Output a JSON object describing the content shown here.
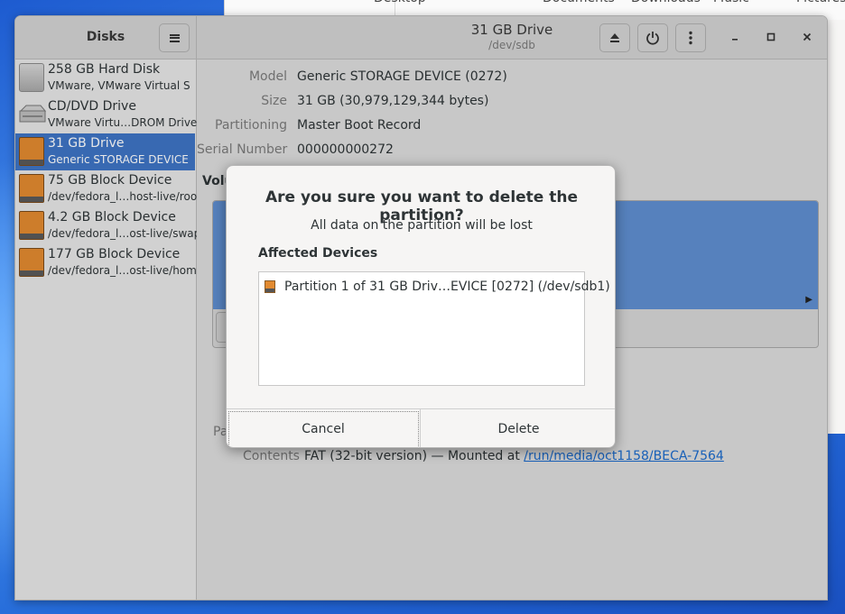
{
  "desktop": {
    "behind_window_labels": [
      "Desktop",
      "Documents",
      "Downloads",
      "Music",
      "Pictures"
    ]
  },
  "sidebar": {
    "title": "Disks",
    "items": [
      {
        "name": "258 GB Hard Disk",
        "desc": "VMware, VMware Virtual S",
        "icon": "hard-disk-icon",
        "selected": false
      },
      {
        "name": "CD/DVD Drive",
        "desc": "VMware Virtu…DROM Drive",
        "icon": "cd-drive-icon",
        "selected": false
      },
      {
        "name": "31 GB Drive",
        "desc": "Generic STORAGE DEVICE",
        "icon": "usb-drive-icon",
        "selected": true
      },
      {
        "name": "75 GB Block Device",
        "desc": "/dev/fedora_l…host-live/root",
        "icon": "block-device-icon",
        "selected": false
      },
      {
        "name": "4.2 GB Block Device",
        "desc": "/dev/fedora_l…ost-live/swap",
        "icon": "block-device-icon",
        "selected": false
      },
      {
        "name": "177 GB Block Device",
        "desc": "/dev/fedora_l…ost-live/home",
        "icon": "block-device-icon",
        "selected": false
      }
    ]
  },
  "header": {
    "title": "31 GB Drive",
    "subtitle": "/dev/sdb",
    "icons": [
      "eject-icon",
      "power-icon",
      "more-options-icon",
      "minimize-icon",
      "maximize-icon",
      "close-icon"
    ]
  },
  "drive": {
    "model_label": "Model",
    "model": "Generic STORAGE DEVICE (0272)",
    "size_label": "Size",
    "size": "31 GB (30,979,129,344 bytes)",
    "partitioning_label": "Partitioning",
    "partitioning": "Master Boot Record",
    "serial_label": "Serial Number",
    "serial": "000000000272",
    "volumes_label": "Volu",
    "partition_label_partial": "Pa",
    "contents_label": "Contents",
    "contents_text": "FAT (32-bit version) — Mounted at ",
    "contents_link": "/run/media/oct1158/BECA-7564"
  },
  "dialog": {
    "title": "Are you sure you want to delete the partition?",
    "subtitle": "All data on the partition will be lost",
    "section": "Affected Devices",
    "devices": [
      "Partition 1 of 31 GB Driv…EVICE [0272] (/dev/sdb1)"
    ],
    "cancel_label": "Cancel",
    "delete_label": "Delete"
  },
  "colors": {
    "selection": "#3e74c4",
    "volume_bar": "#5f8ed0",
    "link": "#1b6acb",
    "drive_orange": "#e28a30"
  }
}
